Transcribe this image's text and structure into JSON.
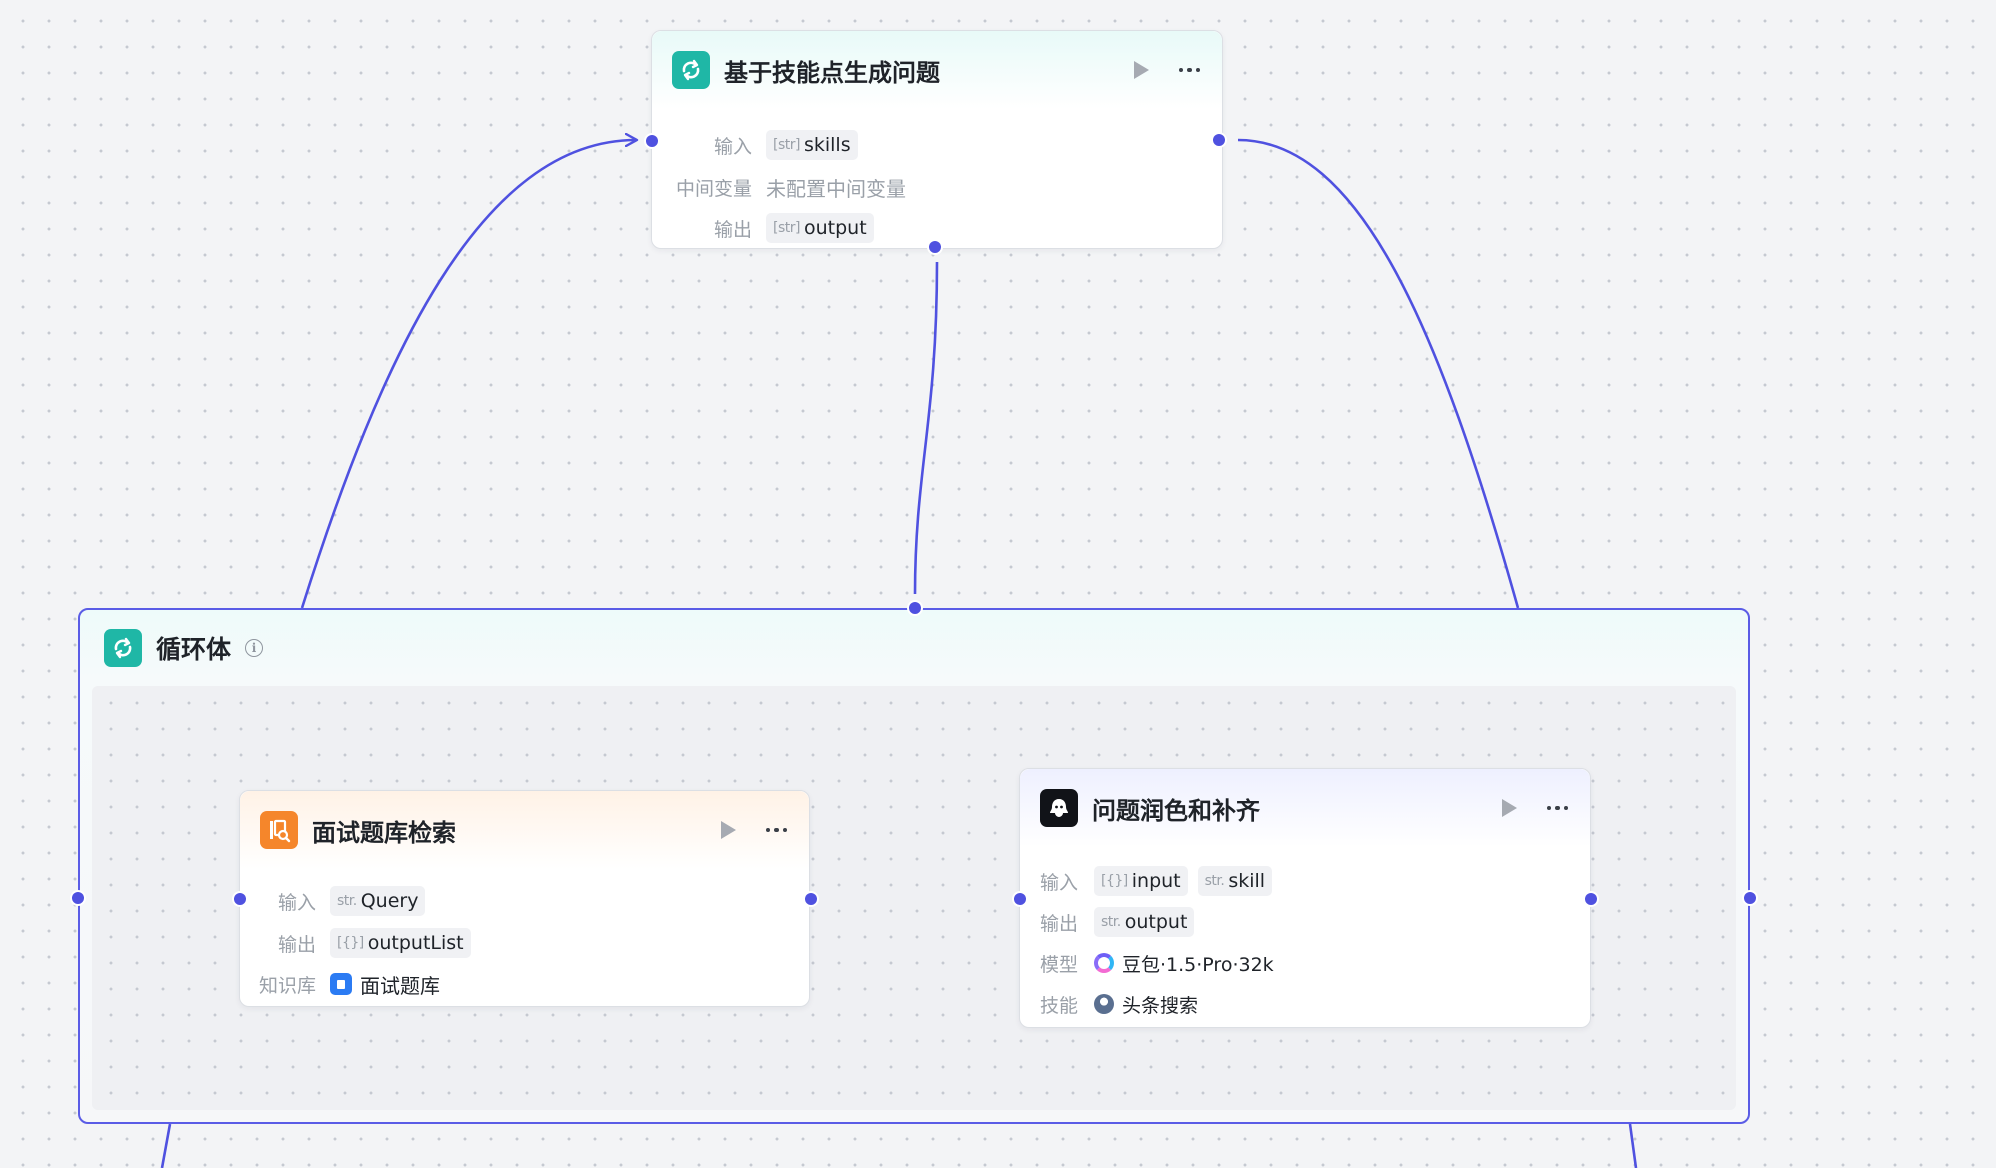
{
  "colors": {
    "edge": "#4f51e0",
    "accent_teal": "#1fb7a6",
    "accent_orange": "#f5862b",
    "knowledge_blue": "#2b7bf3"
  },
  "top_node": {
    "title": "基于技能点生成问题",
    "icon": "loop-icon",
    "input_label": "输入",
    "input_tag": {
      "type": "[str]",
      "name": "skills"
    },
    "intermediate_label": "中间变量",
    "intermediate_value": "未配置中间变量",
    "output_label": "输出",
    "output_tag": {
      "type": "[str]",
      "name": "output"
    }
  },
  "loop": {
    "title": "循环体",
    "icon": "loop-icon",
    "info_icon": "info-icon"
  },
  "search_node": {
    "title": "面试题库检索",
    "icon": "knowledge-search-icon",
    "input_label": "输入",
    "input_tag": {
      "type": "str.",
      "name": "Query"
    },
    "output_label": "输出",
    "output_tag": {
      "type": "[{}]",
      "name": "outputList"
    },
    "kb_label": "知识库",
    "kb_value": "面试题库"
  },
  "polish_node": {
    "title": "问题润色和补齐",
    "icon": "llm-icon",
    "input_label": "输入",
    "input_tags": [
      {
        "type": "[{}]",
        "name": "input"
      },
      {
        "type": "str.",
        "name": "skill"
      }
    ],
    "output_label": "输出",
    "output_tag": {
      "type": "str.",
      "name": "output"
    },
    "model_label": "模型",
    "model_value": "豆包·1.5·Pro·32k",
    "skill_label": "技能",
    "skill_value": "头条搜索"
  }
}
